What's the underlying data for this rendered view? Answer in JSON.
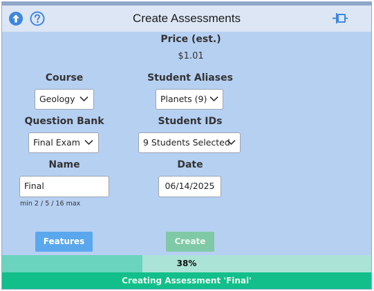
{
  "header": {
    "title": "Create Assessments",
    "icons": [
      "arrow-up-circle-icon",
      "question-circle-icon",
      "pin-icon"
    ]
  },
  "price": {
    "label": "Price (est.)",
    "value": "$1.01"
  },
  "course": {
    "label": "Course",
    "value": "Geology"
  },
  "aliases": {
    "label": "Student Aliases",
    "value": "Planets (9)"
  },
  "bank": {
    "label": "Question Bank",
    "value": "Final Exam"
  },
  "ids": {
    "label": "Student IDs",
    "value": "9 Students Selected"
  },
  "name": {
    "label": "Name",
    "value": "Final",
    "hint": "min 2 / 5 / 16 max"
  },
  "date": {
    "label": "Date",
    "value": "06/14/2025"
  },
  "buttons": {
    "features": "Features",
    "create": "Create"
  },
  "progress": {
    "percent": 38,
    "label": "38%"
  },
  "status": "Creating Assessment 'Final'",
  "colors": {
    "panel": "#b6d0f2",
    "header": "#dce6f4",
    "accent_blue": "#5aa7ee",
    "progress_fill": "#6ad4bf",
    "status_bar": "#12bf8a"
  }
}
